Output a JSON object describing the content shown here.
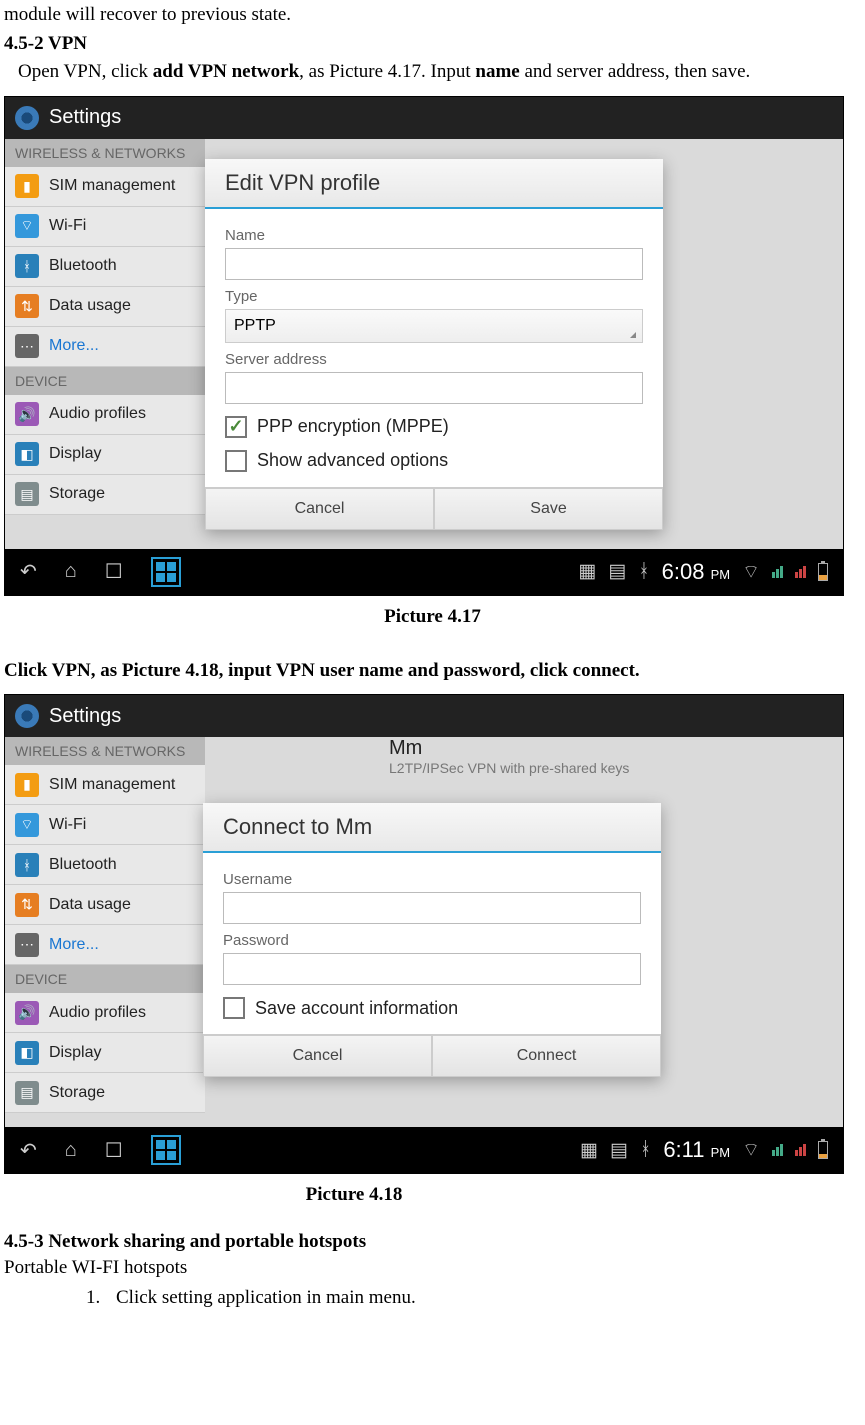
{
  "line1": "module will recover to previous state.",
  "h452": "4.5-2 VPN",
  "vpn_open": "Open VPN, click ",
  "vpn_addnet": "add VPN network",
  "vpn_aspic": ", as Picture 4.17. Input ",
  "vpn_name": "name",
  "vpn_rest": " and server address, then save.",
  "cap417": "Picture 4.17",
  "clickvpn": "Click VPN, as Picture 4.18, input VPN user name and password, click connect.",
  "cap418": "Picture 4.18",
  "h453": "4.5-3 Network sharing and portable hotspots",
  "portable": "Portable WI-FI hotspots",
  "step1n": "1.",
  "step1t": "Click setting application in main menu.",
  "settings_title": "Settings",
  "sec_wireless": "WIRELESS & NETWORKS",
  "sec_device": "DEVICE",
  "sb_sim": "SIM management",
  "sb_wifi": "Wi-Fi",
  "sb_bt": "Bluetooth",
  "sb_data": "Data usage",
  "sb_more": "More...",
  "sb_audio": "Audio profiles",
  "sb_disp": "Display",
  "sb_stor": "Storage",
  "d1_title": "Edit VPN profile",
  "d1_name": "Name",
  "d1_type": "Type",
  "d1_pptp": "PPTP",
  "d1_server": "Server address",
  "d1_ppe": "PPP encryption (MPPE)",
  "d1_adv": "Show advanced options",
  "d1_cancel": "Cancel",
  "d1_save": "Save",
  "vpn_list_name": "Mm",
  "vpn_list_sub": "L2TP/IPSec VPN with pre-shared keys",
  "d2_title": "Connect to Mm",
  "d2_user": "Username",
  "d2_pass": "Password",
  "d2_save": "Save account information",
  "d2_cancel": "Cancel",
  "d2_connect": "Connect",
  "time1": "6:08",
  "time1pm": "PM",
  "time2": "6:11",
  "time2pm": "PM"
}
